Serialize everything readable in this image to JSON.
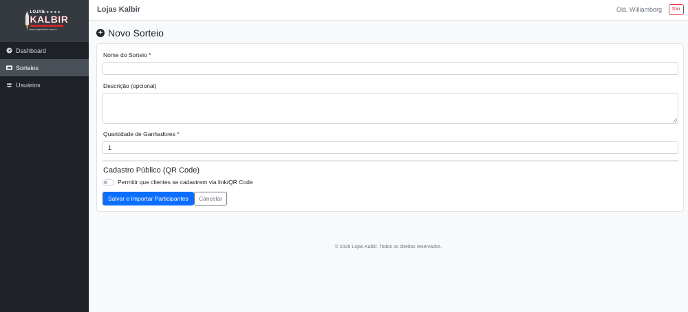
{
  "sidebar": {
    "logo": {
      "top_text": "LOJAS",
      "main_text": "KALBIR",
      "stars": "★★★★★",
      "url_text": "www.lojaskalbir.com.br"
    },
    "items": [
      {
        "label": "Dashboard",
        "icon": "dashboard-gauge-icon",
        "active": false
      },
      {
        "label": "Sorteios",
        "icon": "ticket-icon",
        "active": true
      },
      {
        "label": "Usuários",
        "icon": "users-icon",
        "active": false
      }
    ]
  },
  "header": {
    "brand": "Lojas Kalbir",
    "greeting": "Olá, Williamberg",
    "logout_label": "Sair"
  },
  "page": {
    "title": "Novo Sorteio",
    "title_icon": "plus-circle-icon"
  },
  "form": {
    "name_label": "Nome do Sorteio *",
    "name_value": "",
    "description_label": "Descrição (opcional)",
    "description_value": "",
    "winners_label": "Quantidade de Ganhadores *",
    "winners_value": "1",
    "public_section_title": "Cadastro Público (QR Code)",
    "public_toggle_label": "Permitir que clientes se cadastrem via link/QR Code",
    "public_toggle_on": false,
    "submit_label": "Salvar e Importar Participantes",
    "cancel_label": "Cancelar"
  },
  "footer": {
    "text": "© 2026 Lojas Kalbir. Todos os direitos reservados."
  },
  "colors": {
    "sidebar_bg": "#1e2226",
    "sidebar_active": "#495057",
    "primary": "#0d6efd",
    "danger": "#dc3545"
  }
}
